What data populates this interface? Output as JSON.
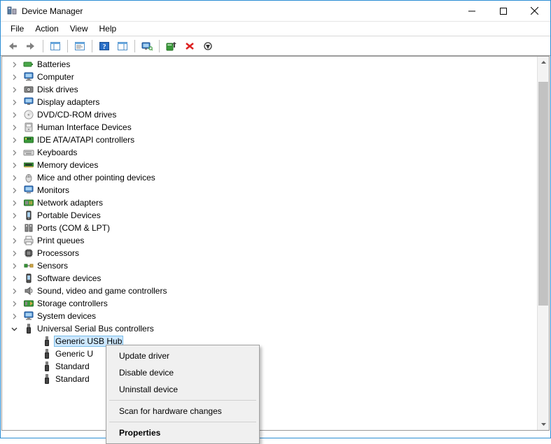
{
  "window": {
    "title": "Device Manager"
  },
  "menu": [
    "File",
    "Action",
    "View",
    "Help"
  ],
  "tree": {
    "items": [
      {
        "label": "Batteries",
        "icon": "battery",
        "expanded": false
      },
      {
        "label": "Computer",
        "icon": "computer",
        "expanded": false
      },
      {
        "label": "Disk drives",
        "icon": "disk",
        "expanded": false
      },
      {
        "label": "Display adapters",
        "icon": "display",
        "expanded": false
      },
      {
        "label": "DVD/CD-ROM drives",
        "icon": "optical",
        "expanded": false
      },
      {
        "label": "Human Interface Devices",
        "icon": "hid",
        "expanded": false
      },
      {
        "label": "IDE ATA/ATAPI controllers",
        "icon": "idecard",
        "expanded": false
      },
      {
        "label": "Keyboards",
        "icon": "keyboard",
        "expanded": false
      },
      {
        "label": "Memory devices",
        "icon": "memory",
        "expanded": false
      },
      {
        "label": "Mice and other pointing devices",
        "icon": "mouse",
        "expanded": false
      },
      {
        "label": "Monitors",
        "icon": "monitor",
        "expanded": false
      },
      {
        "label": "Network adapters",
        "icon": "netadapter",
        "expanded": false
      },
      {
        "label": "Portable Devices",
        "icon": "portable",
        "expanded": false
      },
      {
        "label": "Ports (COM & LPT)",
        "icon": "ports",
        "expanded": false
      },
      {
        "label": "Print queues",
        "icon": "printer",
        "expanded": false
      },
      {
        "label": "Processors",
        "icon": "cpu",
        "expanded": false
      },
      {
        "label": "Sensors",
        "icon": "sensor",
        "expanded": false
      },
      {
        "label": "Software devices",
        "icon": "software",
        "expanded": false
      },
      {
        "label": "Sound, video and game controllers",
        "icon": "sound",
        "expanded": false
      },
      {
        "label": "Storage controllers",
        "icon": "storage",
        "expanded": false
      },
      {
        "label": "System devices",
        "icon": "system",
        "expanded": false
      },
      {
        "label": "Universal Serial Bus controllers",
        "icon": "usb",
        "expanded": true,
        "children": [
          {
            "label": "Generic USB Hub",
            "icon": "usb",
            "selected": true
          },
          {
            "label": "Generic U",
            "icon": "usb"
          },
          {
            "label": "Standard",
            "icon": "usb"
          },
          {
            "label": "Standard",
            "icon": "usb"
          }
        ]
      }
    ]
  },
  "context_menu": {
    "items": [
      {
        "label": "Update driver"
      },
      {
        "label": "Disable device"
      },
      {
        "label": "Uninstall device"
      },
      {
        "sep": true
      },
      {
        "label": "Scan for hardware changes"
      },
      {
        "sep": true
      },
      {
        "label": "Properties",
        "bold": true
      }
    ]
  }
}
